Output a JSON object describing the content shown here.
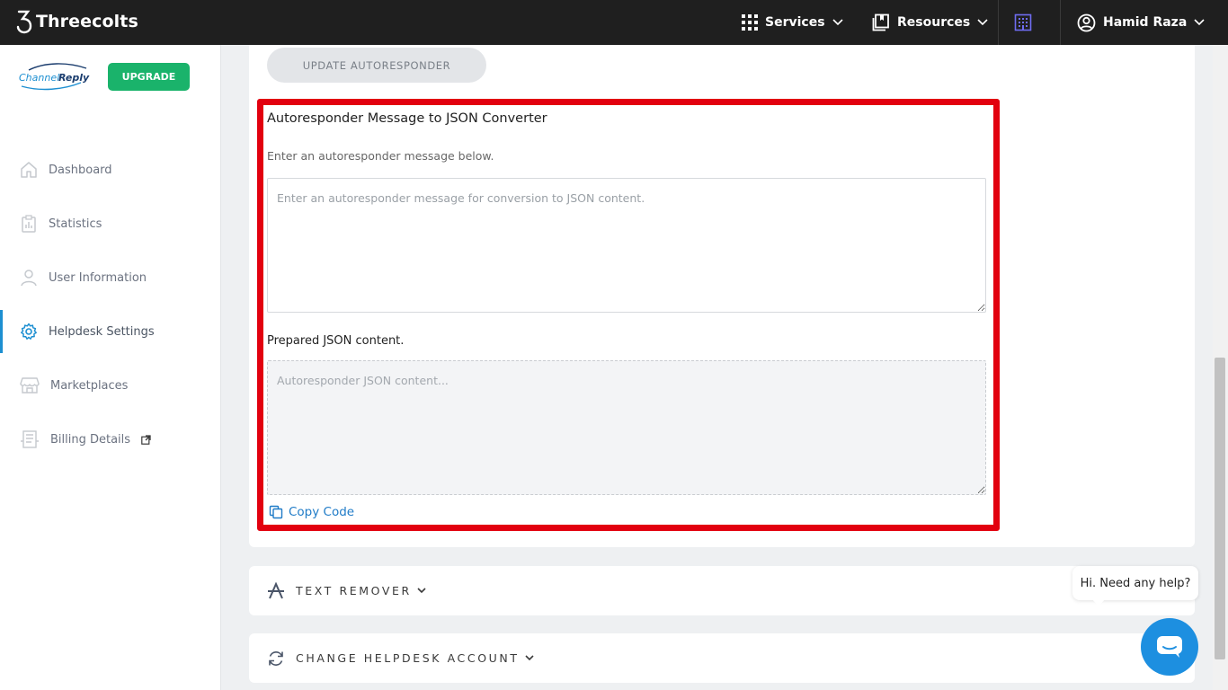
{
  "topbar": {
    "brand": "Threecolts",
    "services_label": "Services",
    "resources_label": "Resources",
    "user_name": "Hamid Raza"
  },
  "sidebar": {
    "logo_text": "ChannelReply",
    "upgrade_label": "UPGRADE",
    "items": [
      {
        "label": "Dashboard",
        "icon": "home-icon"
      },
      {
        "label": "Statistics",
        "icon": "clipboard-chart-icon"
      },
      {
        "label": "User Information",
        "icon": "user-icon"
      },
      {
        "label": "Helpdesk Settings",
        "icon": "gear-icon"
      },
      {
        "label": "Marketplaces",
        "icon": "store-icon"
      },
      {
        "label": "Billing Details",
        "icon": "receipt-icon"
      }
    ],
    "active_item": "Helpdesk Settings"
  },
  "main": {
    "update_button_label": "UPDATE AUTORESPONDER",
    "converter": {
      "title": "Autoresponder Message to JSON Converter",
      "subtitle": "Enter an autoresponder message below.",
      "message_placeholder": "Enter an autoresponder message for conversion to JSON content.",
      "message_value": "",
      "json_label": "Prepared JSON content.",
      "json_placeholder": "Autoresponder JSON content...",
      "copy_label": "Copy Code"
    },
    "panels": [
      {
        "label": "TEXT REMOVER",
        "icon": "strikethrough-a-icon"
      },
      {
        "label": "CHANGE HELPDESK ACCOUNT",
        "icon": "refresh-icon"
      }
    ]
  },
  "help": {
    "bubble_text": "Hi. Need any help?"
  },
  "colors": {
    "topbar": "#1f1f1f",
    "accent": "#1d8fd1",
    "upgrade": "#1ab36b",
    "highlight": "#e2000f",
    "link": "#1f7bc7"
  }
}
